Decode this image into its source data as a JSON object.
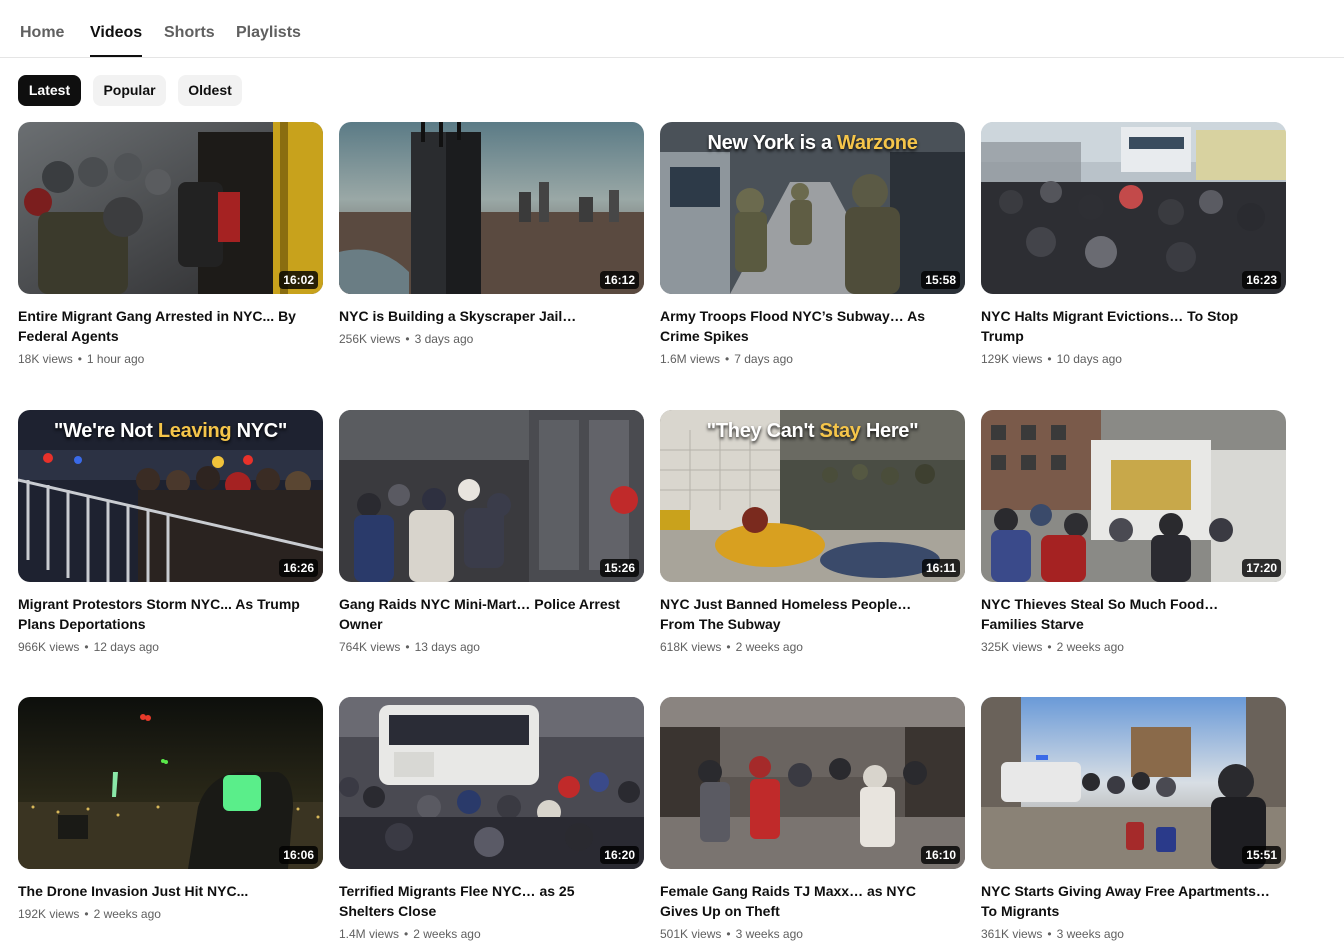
{
  "tabs": [
    {
      "label": "Home"
    },
    {
      "label": "Videos"
    },
    {
      "label": "Shorts"
    },
    {
      "label": "Playlists"
    }
  ],
  "active_tab": "Videos",
  "filters": [
    {
      "label": "Latest"
    },
    {
      "label": "Popular"
    },
    {
      "label": "Oldest"
    }
  ],
  "active_filter": "Latest",
  "videos": [
    {
      "title": "Entire Migrant Gang Arrested in NYC... By Federal Agents",
      "views": "18K views",
      "age": "1 hour ago",
      "duration": "16:02"
    },
    {
      "title": "NYC is Building a Skyscraper Jail…",
      "views": "256K views",
      "age": "3 days ago",
      "duration": "16:12"
    },
    {
      "title": "Army Troops Flood NYC’s Subway… As Crime Spikes",
      "views": "1.6M views",
      "age": "7 days ago",
      "duration": "15:58",
      "overlay_pre": "New York is a ",
      "overlay_hl": "Warzone",
      "overlay_post": ""
    },
    {
      "title": "NYC Halts Migrant Evictions… To Stop Trump",
      "views": "129K views",
      "age": "10 days ago",
      "duration": "16:23"
    },
    {
      "title": "Migrant Protestors Storm NYC... As Trump Plans Deportations",
      "views": "966K views",
      "age": "12 days ago",
      "duration": "16:26",
      "overlay_pre": "\"We're Not ",
      "overlay_hl": "Leaving",
      "overlay_post": " NYC\""
    },
    {
      "title": "Gang Raids NYC Mini-Mart… Police Arrest Owner",
      "views": "764K views",
      "age": "13 days ago",
      "duration": "15:26"
    },
    {
      "title": "NYC Just Banned Homeless People… From The Subway",
      "views": "618K views",
      "age": "2 weeks ago",
      "duration": "16:11",
      "overlay_pre": "\"They Can't ",
      "overlay_hl": "Stay",
      "overlay_post": " Here\""
    },
    {
      "title": "NYC Thieves Steal So Much Food… Families Starve",
      "views": "325K views",
      "age": "2 weeks ago",
      "duration": "17:20"
    },
    {
      "title": "The Drone Invasion Just Hit NYC...",
      "views": "192K views",
      "age": "2 weeks ago",
      "duration": "16:06"
    },
    {
      "title": "Terrified Migrants Flee NYC… as 25 Shelters Close",
      "views": "1.4M views",
      "age": "2 weeks ago",
      "duration": "16:20"
    },
    {
      "title": "Female Gang Raids TJ Maxx… as NYC Gives Up on Theft",
      "views": "501K views",
      "age": "3 weeks ago",
      "duration": "16:10"
    },
    {
      "title": "NYC Starts Giving Away Free Apartments… To Migrants",
      "views": "361K views",
      "age": "3 weeks ago",
      "duration": "15:51"
    }
  ],
  "colors": {
    "accent": "#0f0f0f",
    "chip_bg": "#f2f2f2",
    "meta_text": "#606060",
    "overlay_highlight": "#f5c54a"
  }
}
